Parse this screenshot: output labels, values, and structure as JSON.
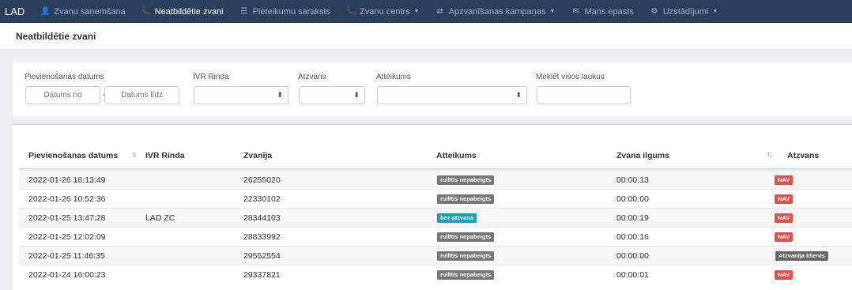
{
  "navbar": {
    "brand": "LAD",
    "items": [
      {
        "label": "Zvanu saņemšana",
        "icon": "user-icon",
        "glyph": "👤",
        "caret": false
      },
      {
        "label": "Neatbildētie zvani",
        "icon": "phone-icon",
        "glyph": "📞",
        "caret": false
      },
      {
        "label": "Pieteikumu saraksts",
        "icon": "list-icon",
        "glyph": "☰",
        "caret": false
      },
      {
        "label": "Zvanu centrs",
        "icon": "phone-icon",
        "glyph": "📞",
        "caret": true
      },
      {
        "label": "Apzvanīšanas kampaņas",
        "icon": "campaign-icon",
        "glyph": "⇄",
        "caret": true
      },
      {
        "label": "Mans epasts",
        "icon": "envelope-icon",
        "glyph": "✉",
        "caret": false
      },
      {
        "label": "Uzstādījumi",
        "icon": "gears-icon",
        "glyph": "⚙",
        "caret": true
      }
    ]
  },
  "page": {
    "title": "Neatbildētie zvani"
  },
  "filters": {
    "date_label": "Pievienošanas datums",
    "date_from_placeholder": "Datums no",
    "date_to_placeholder": "Datums līdz",
    "ivr_label": "IVR Rinda",
    "callback_label": "Atzvans",
    "reason_label": "Atteikums",
    "search_label": "Meklēt visos laukus",
    "search_value": "",
    "select_arrow": "⬍"
  },
  "table": {
    "columns": [
      "Pievienošanas datums",
      "IVR Rinda",
      "Zvanīja",
      "Atteikums",
      "Zvana ilgums",
      "Atzvans"
    ],
    "sort_glyph": "⇅",
    "rows": [
      {
        "date": "2022-01-26 16:13:49",
        "ivr": "",
        "caller": "26255020",
        "reason": "rullītis nepabeigts",
        "duration": "00:00:13",
        "callback": "NAV"
      },
      {
        "date": "2022-01-26 10:52:36",
        "ivr": "",
        "caller": "22330102",
        "reason": "rullītis nepabeigts",
        "duration": "00:00:00",
        "callback": "NAV"
      },
      {
        "date": "2022-01-25 13:47:28",
        "ivr": "LAD ZC",
        "caller": "28344103",
        "reason": "bez atzvana",
        "duration": "00:00:19",
        "callback": "NAV"
      },
      {
        "date": "2022-01-25 12:02:09",
        "ivr": "",
        "caller": "28833992",
        "reason": "rullītis nepabeigts",
        "duration": "00:00:16",
        "callback": "NAV"
      },
      {
        "date": "2022-01-25 11:46:35",
        "ivr": "",
        "caller": "29552554",
        "reason": "rullītis nepabeigts",
        "duration": "00:00:00",
        "callback": "Atzvanīja klients"
      },
      {
        "date": "2022-01-24 16:00:23",
        "ivr": "",
        "caller": "29337821",
        "reason": "rullītis nepabeigts",
        "duration": "00:00:01",
        "callback": "NAV"
      }
    ]
  },
  "colors": {
    "navbar_bg": "#2b3e5c",
    "badge_gray": "#777777",
    "badge_teal": "#17a2b8",
    "badge_red": "#d9534f",
    "badge_dark": "#666666"
  }
}
